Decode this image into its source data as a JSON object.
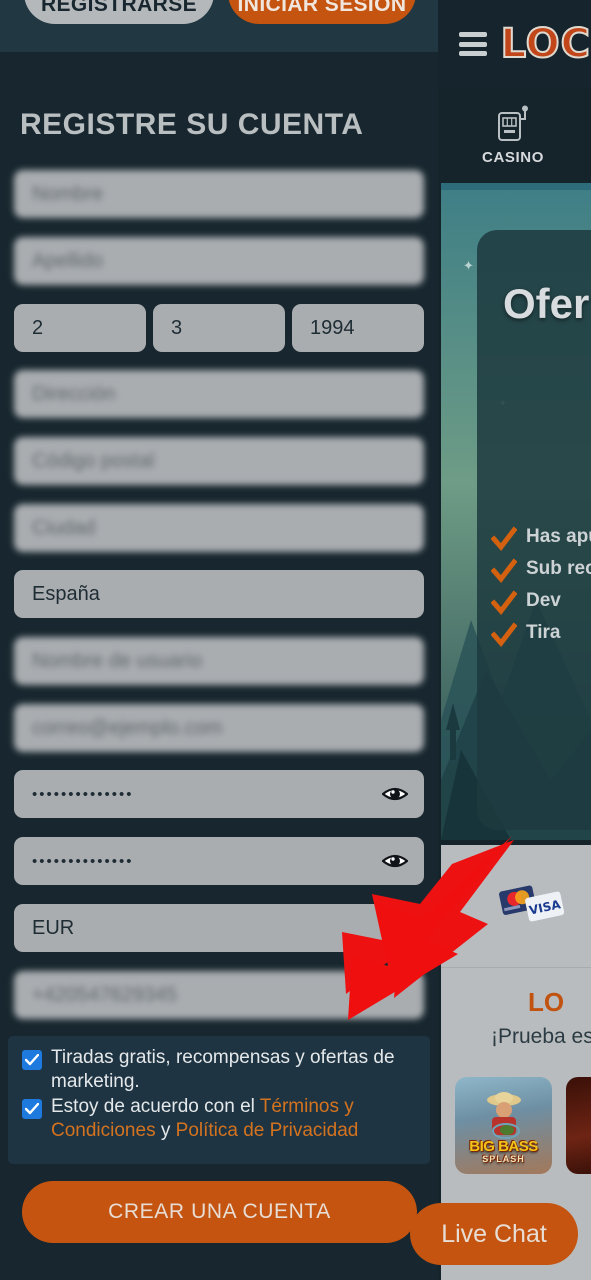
{
  "background_page": {
    "header": {
      "menu_icon": "hamburger-menu-icon",
      "logo_text": "LOC"
    },
    "nav": {
      "icon": "slot-machine-icon",
      "label": "CASINO"
    },
    "promo_banner": {
      "title": "Ofer",
      "bullets": [
        "Has    apu",
        "Sub    rec",
        "Dev",
        "Tira"
      ]
    },
    "payments": {
      "icons": [
        "mastercard-icon",
        "visa-icon"
      ]
    },
    "lower_promo": {
      "title": "LO",
      "subtitle": "¡Prueba es"
    },
    "games": [
      {
        "title": "BIG BASS",
        "subtitle": "SPLASH"
      },
      {
        "title": "",
        "subtitle": ""
      }
    ]
  },
  "modal": {
    "top_buttons": {
      "register": "REGISTRARSE",
      "login": "INICIAR SESIÓN"
    },
    "title": "REGISTRE SU CUENTA",
    "fields": [
      {
        "name": "first-name",
        "value": "Nombre",
        "blurred": true
      },
      {
        "name": "last-name",
        "value": "Apellido",
        "blurred": true
      },
      {
        "name": "birth-day",
        "value": "2",
        "blurred": false
      },
      {
        "name": "birth-month",
        "value": "3",
        "blurred": false
      },
      {
        "name": "birth-year",
        "value": "1994",
        "blurred": false
      },
      {
        "name": "address",
        "value": "Dirección",
        "blurred": true
      },
      {
        "name": "postal-code",
        "value": "Código postal",
        "blurred": true
      },
      {
        "name": "city",
        "value": "Ciudad",
        "blurred": true
      },
      {
        "name": "country",
        "value": "España",
        "blurred": false
      },
      {
        "name": "username",
        "value": "Nombre de usuario",
        "blurred": true
      },
      {
        "name": "email",
        "value": "correo@ejemplo.com",
        "blurred": true
      },
      {
        "name": "password",
        "value": "••••••••••••••",
        "blurred": false
      },
      {
        "name": "password-confirm",
        "value": "••••••••••••••",
        "blurred": false
      },
      {
        "name": "currency",
        "value": "EUR",
        "blurred": false
      },
      {
        "name": "phone",
        "value": "+420547629345",
        "blurred": true
      }
    ],
    "consent": {
      "marketing": "Tiradas gratis, recompensas y ofertas de marketing.",
      "terms_prefix": "Estoy de acuerdo con el ",
      "terms_link": "Términos y Condiciones",
      "terms_joiner": " y ",
      "privacy_link": "Política de Privacidad"
    },
    "submit_label": "CREAR UNA CUENTA"
  },
  "widgets": {
    "live_chat": "Live Chat"
  },
  "annotation": {
    "arrow": "red-arrow-pointing-to-phone-field",
    "color": "#ee1111"
  },
  "colors": {
    "page_bg": "#18272f",
    "topbar": "#213742",
    "accent_orange": "#c4540f",
    "link_orange": "#d4731f",
    "field_gray": "#a9adb0",
    "checkbox_blue": "#1f7ae0",
    "teal": "#2e6c7b"
  }
}
